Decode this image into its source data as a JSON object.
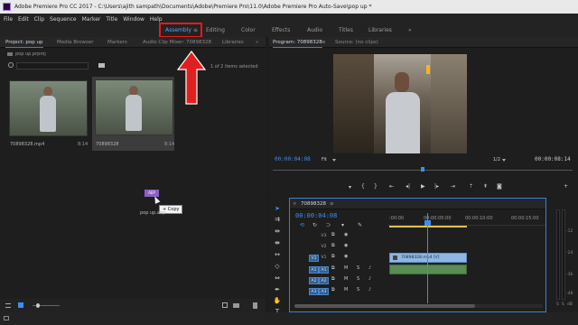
{
  "window": {
    "title": "Adobe Premiere Pro CC 2017 - C:\\Users\\ajith sampath\\Documents\\Adobe\\Premiere Pro\\11.0\\Adobe Premiere Pro Auto-Save\\pop up *"
  },
  "menu": [
    "File",
    "Edit",
    "Clip",
    "Sequence",
    "Marker",
    "Title",
    "Window",
    "Help"
  ],
  "workspaces": {
    "tabs": [
      "Assembly",
      "Editing",
      "Color",
      "Effects",
      "Audio",
      "Titles",
      "Libraries"
    ],
    "active": "Assembly",
    "more": "»",
    "menu_glyph": "≡"
  },
  "project_panel": {
    "tabs": [
      "Project: pop up",
      "Media Browser",
      "Markers",
      "Audio Clip Mixer: 70898328",
      "Libraries"
    ],
    "more": "»",
    "file_name": "pop up.prproj",
    "items_selected": "1 of 2 items selected",
    "clips": [
      {
        "name": "70898328.mp4",
        "duration": "8:14"
      },
      {
        "name": "70898328",
        "duration": "8:14"
      }
    ],
    "drag": {
      "icon_text": "AEP",
      "tooltip": "+ Copy",
      "label": "pop up.aep"
    }
  },
  "program_monitor": {
    "tabs": [
      "Program: 70898328",
      "Source: (no clips)"
    ],
    "menu_glyph": "≡",
    "timecode": "00:00:04:08",
    "fit": "Fit",
    "resolution": "1/2",
    "duration": "00:00:08:14",
    "accent_color": "#3c8ff0"
  },
  "timeline": {
    "tab": "70898328",
    "timecode": "00:00:04:08",
    "ruler": [
      ":00:00",
      "00:00:05:00",
      "00:00:10:00",
      "00:00:15:00"
    ],
    "video_tracks": [
      "V3",
      "V2",
      "V1"
    ],
    "audio_tracks": [
      "A1",
      "A2",
      "A3"
    ],
    "clip_label": "70898328.mp4 [V]",
    "track_buttons": {
      "mute": "M",
      "solo": "S"
    },
    "meter_labels": [
      "-12",
      "-24",
      "-36",
      "-48",
      "dB"
    ],
    "clip_color": "#8fb7e3"
  }
}
